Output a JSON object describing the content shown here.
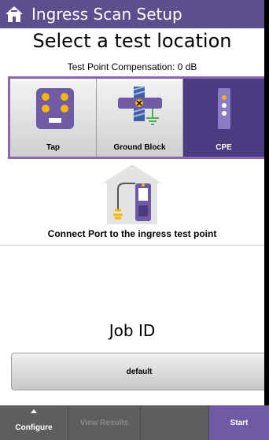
{
  "header": {
    "app_title": "Ingress Scan Setup",
    "home_icon": "home-icon"
  },
  "main": {
    "page_title": "Select a test location",
    "compensation_text": "Test Point Compensation: 0 dB",
    "locations": [
      {
        "label": "Tap",
        "icon": "tap-icon",
        "selected": false
      },
      {
        "label": "Ground Block",
        "icon": "ground-block-icon",
        "selected": false
      },
      {
        "label": "CPE",
        "icon": "cpe-icon",
        "selected": true
      }
    ],
    "illustration_icon": "connect-port-illustration",
    "instruction": "Connect Port to the ingress test point",
    "job_label": "Job ID",
    "job_value": "default"
  },
  "bottom_nav": {
    "configure": "Configure",
    "view_results": "View Results",
    "empty": "",
    "start": "Start"
  },
  "colors": {
    "accent": "#5d4e8e",
    "selected": "#4b3b81",
    "border": "#8c66b3",
    "start": "#6f5aa6",
    "navbar": "#5e5e5e",
    "tap_icon_body": "#6f5aa6",
    "tap_icon_port": "#f5b800",
    "ground_green": "#4caf50",
    "ground_blue": "#3c5fa8"
  }
}
